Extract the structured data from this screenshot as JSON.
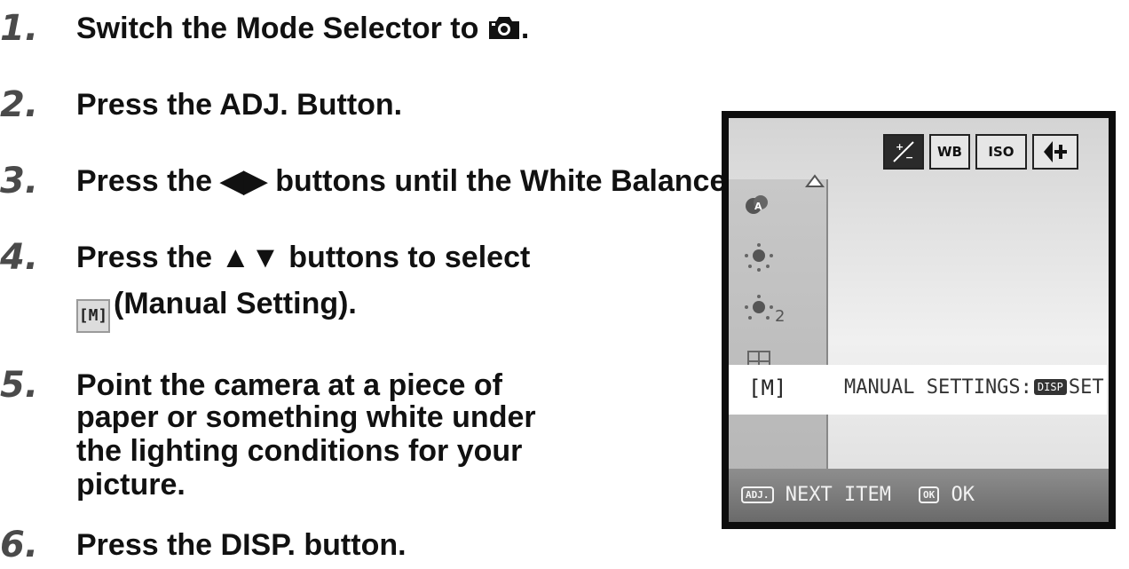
{
  "steps": [
    {
      "number": "1.",
      "text": "Switch the Mode Selector to ",
      "suffix": "."
    },
    {
      "number": "2.",
      "text": "Press the ADJ. Button."
    },
    {
      "number": "3.",
      "text": "Press the ◀▶ buttons until the White Balance menu appears."
    },
    {
      "number": "4.",
      "text": "Press the ▲▼ buttons to select",
      "line2": "(Manual Setting).",
      "icon_label": "[M]"
    },
    {
      "number": "5.",
      "lines": [
        "Point the camera at a piece of",
        "paper or something white under",
        "the lighting conditions for your",
        "picture."
      ]
    },
    {
      "number": "6.",
      "text": "Press the DISP. button."
    }
  ],
  "icons": {
    "mode_icon": "camera-icon",
    "manual_icon": "manual-wb-icon"
  },
  "lcd": {
    "top_icons": [
      "+/-",
      "WB",
      "ISO",
      "flash"
    ],
    "top_icon_names": [
      "exposure-comp-icon",
      "wb-icon",
      "iso-icon",
      "flash-icon"
    ],
    "side_icons": [
      "auto-wb-icon",
      "daylight-icon",
      "fluorescent-1-icon",
      "fluorescent-2-icon"
    ],
    "selected": {
      "label": "[M]",
      "description_prefix": "MANUAL SETTINGS:",
      "disp_badge": "DISP",
      "description_suffix": "SET"
    },
    "bottom": {
      "adj_badge": "ADJ.",
      "next": "NEXT ITEM",
      "ok_badge": "OK",
      "ok": "OK"
    }
  }
}
